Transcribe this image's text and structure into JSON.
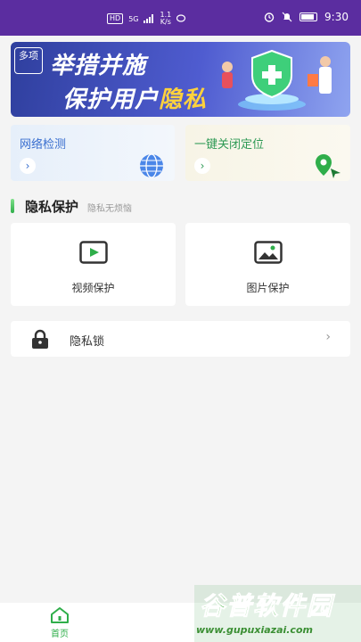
{
  "status_bar": {
    "badge": "HD",
    "signal": "5G",
    "net_speed_value": "1.1",
    "net_speed_unit": "K/s",
    "time": "9:30",
    "icons": [
      "alarm-icon",
      "mute-icon",
      "battery-icon"
    ]
  },
  "banner": {
    "badge": "多项",
    "line1": "举措并施",
    "line2_white": "保护用户",
    "line2_yellow": "隐私",
    "accent": "#ffd23c"
  },
  "features": [
    {
      "label": "网络检测",
      "icon": "globe-icon",
      "color": "#3a6fcf"
    },
    {
      "label": "一键关闭定位",
      "icon": "location-pin-icon",
      "color": "#2e9a55"
    }
  ],
  "section": {
    "title": "隐私保护",
    "subtitle": "隐私无烦恼"
  },
  "protect_cards": [
    {
      "label": "视频保护",
      "icon": "video-icon"
    },
    {
      "label": "图片保护",
      "icon": "image-icon"
    }
  ],
  "lock_row": {
    "label": "隐私锁",
    "icon": "lock-icon"
  },
  "bottom_nav": {
    "home_label": "首页",
    "active_color": "#2fae4a"
  },
  "watermark": {
    "title": "谷普软件园",
    "url": "www.gupuxiazai.com"
  }
}
